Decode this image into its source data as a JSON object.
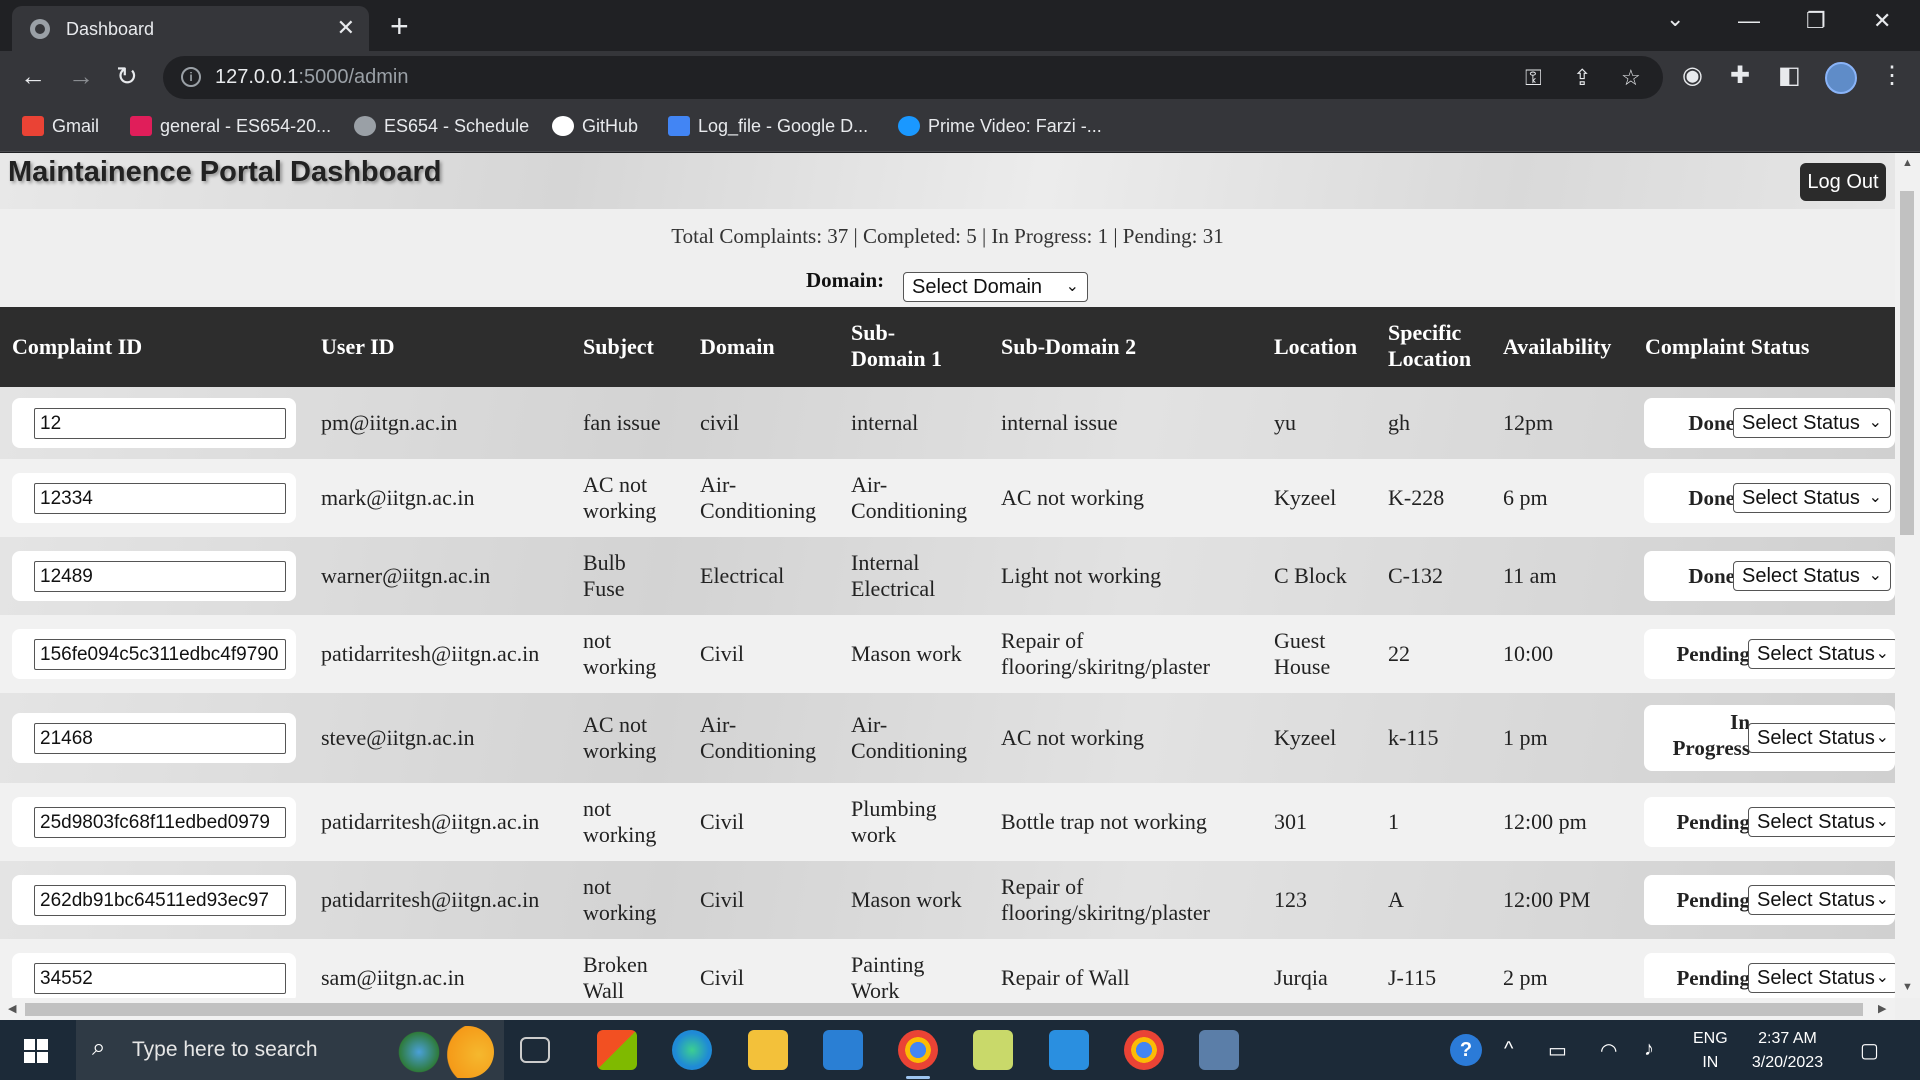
{
  "browser": {
    "tab_title": "Dashboard",
    "url_host": "127.0.0.1",
    "url_rest": ":5000/admin",
    "bookmarks": [
      {
        "label": "Gmail",
        "icon": "gmail-icon",
        "color": "#ea4335"
      },
      {
        "label": "general - ES654-20...",
        "icon": "slack-icon",
        "color": "#e01e5a"
      },
      {
        "label": "ES654 - Schedule",
        "icon": "globe-icon",
        "color": "#9aa0a6"
      },
      {
        "label": "GitHub",
        "icon": "github-icon",
        "color": "#ffffff"
      },
      {
        "label": "Log_file - Google D...",
        "icon": "google-docs-icon",
        "color": "#4285f4"
      },
      {
        "label": "Prime Video: Farzi -...",
        "icon": "prime-video-icon",
        "color": "#1a98ff"
      }
    ]
  },
  "page": {
    "title": "Maintainence Portal Dashboard",
    "logout_label": "Log Out",
    "stats": "Total Complaints: 37 | Completed: 5 | In Progress: 1 | Pending: 31",
    "domain_label": "Domain:",
    "domain_select": "Select Domain"
  },
  "table": {
    "headers": {
      "complaint_id": "Complaint ID",
      "user_id": "User ID",
      "subject": "Subject",
      "domain": "Domain",
      "sub_domain_1": "Sub-\nDomain 1",
      "sub_domain_2": "Sub-Domain 2",
      "location": "Location",
      "specific_location": "Specific\nLocation",
      "availability": "Availability",
      "complaint_status": "Complaint Status"
    },
    "status_select_label": "Select Status",
    "rows": [
      {
        "id": "12",
        "user": "pm@iitgn.ac.in",
        "subject": "fan issue",
        "domain": "civil",
        "sub1": "internal",
        "sub2": "internal issue",
        "location": "yu",
        "spec": "gh",
        "avail": "12pm",
        "status": "Done"
      },
      {
        "id": "12334",
        "user": "mark@iitgn.ac.in",
        "subject": "AC not\nworking",
        "domain": "Air-\nConditioning",
        "sub1": "Air-\nConditioning",
        "sub2": "AC not working",
        "location": "Kyzeel",
        "spec": "K-228",
        "avail": "6 pm",
        "status": "Done"
      },
      {
        "id": "12489",
        "user": "warner@iitgn.ac.in",
        "subject": "Bulb\nFuse",
        "domain": "Electrical",
        "sub1": "Internal\nElectrical",
        "sub2": "Light not working",
        "location": "C Block",
        "spec": "C-132",
        "avail": "11 am",
        "status": "Done"
      },
      {
        "id": "156fe094c5c311edbc4f9790",
        "user": "patidarritesh@iitgn.ac.in",
        "subject": "not\nworking",
        "domain": "Civil",
        "sub1": "Mason work",
        "sub2": "Repair of\nflooring/skiritng/plaster",
        "location": "Guest\nHouse",
        "spec": "22",
        "avail": "10:00",
        "status": "Pending"
      },
      {
        "id": "21468",
        "user": "steve@iitgn.ac.in",
        "subject": "AC not\nworking",
        "domain": "Air-\nConditioning",
        "sub1": "Air-\nConditioning",
        "sub2": "AC not working",
        "location": "Kyzeel",
        "spec": "k-115",
        "avail": "1 pm",
        "status": "In\nProgress"
      },
      {
        "id": "25d9803fc68f11edbed0979",
        "user": "patidarritesh@iitgn.ac.in",
        "subject": "not\nworking",
        "domain": "Civil",
        "sub1": "Plumbing\nwork",
        "sub2": "Bottle trap not working",
        "location": "301",
        "spec": "1",
        "avail": "12:00 pm",
        "status": "Pending"
      },
      {
        "id": "262db91bc64511ed93ec97",
        "user": "patidarritesh@iitgn.ac.in",
        "subject": "not\nworking",
        "domain": "Civil",
        "sub1": "Mason work",
        "sub2": "Repair of\nflooring/skiritng/plaster",
        "location": "123",
        "spec": "A",
        "avail": "12:00 PM",
        "status": "Pending"
      },
      {
        "id": "34552",
        "user": "sam@iitgn.ac.in",
        "subject": "Broken\nWall",
        "domain": "Civil",
        "sub1": "Painting\nWork",
        "sub2": "Repair of Wall",
        "location": "Jurqia",
        "spec": "J-115",
        "avail": "2 pm",
        "status": "Pending"
      }
    ]
  },
  "taskbar": {
    "search_placeholder": "Type here to search",
    "lang_line1": "ENG",
    "lang_line2": "IN",
    "time": "2:37 AM",
    "date": "3/20/2023"
  }
}
